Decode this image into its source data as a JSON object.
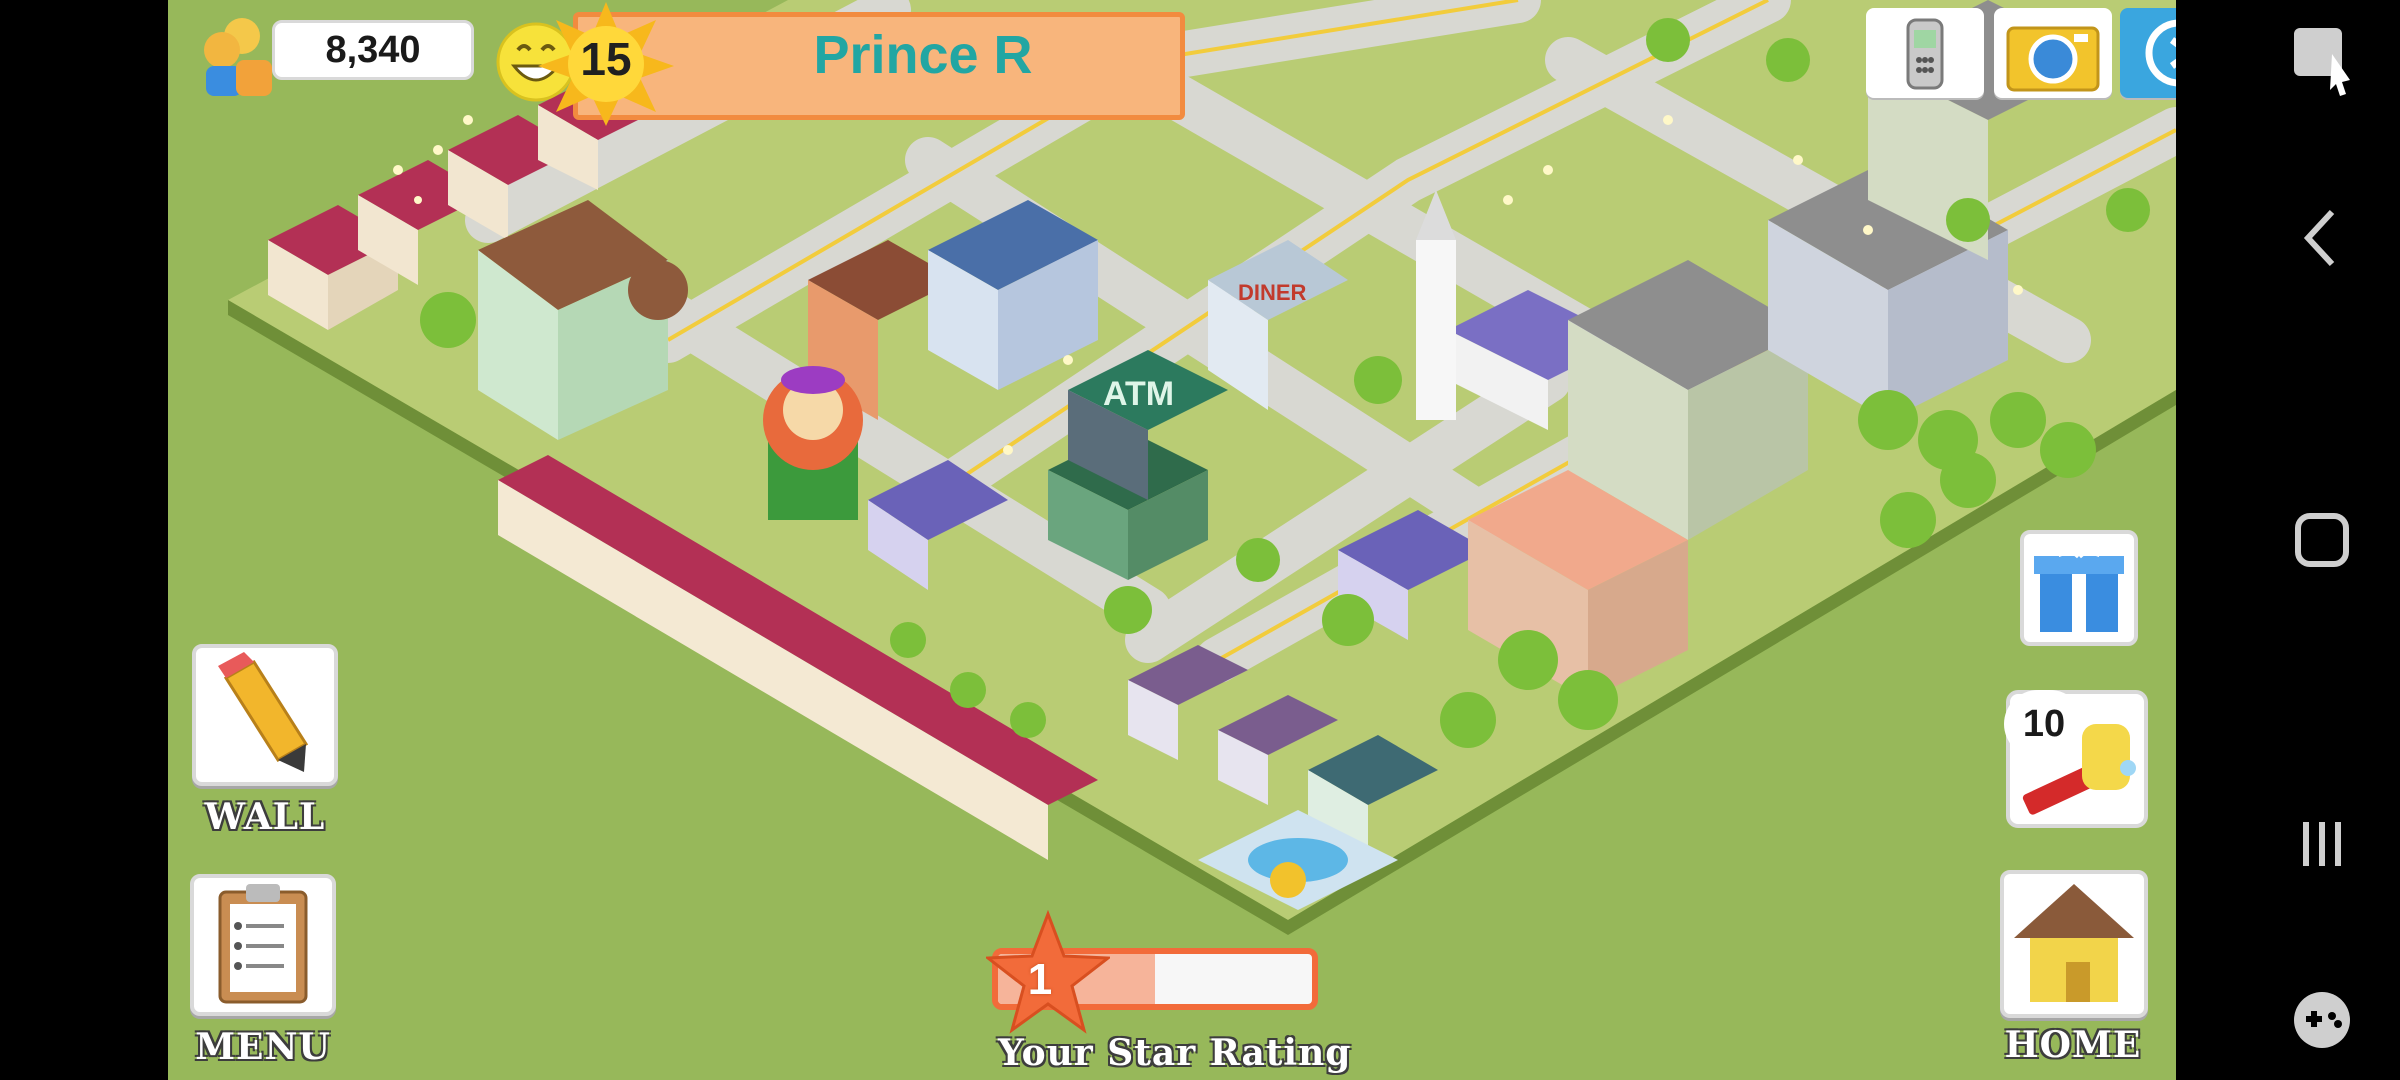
{
  "hud": {
    "coins": "8,340",
    "level": "15",
    "player_name": "Prince R",
    "cleanup_count": "10"
  },
  "buttons": {
    "wall_label": "WALL",
    "menu_label": "MENU",
    "home_label": "HOME"
  },
  "rating": {
    "value": "1",
    "label": "Your Star Rating",
    "progress_fraction": 0.5
  },
  "icons": {
    "coins": "coins-people-icon",
    "happiness": "smiley-face-icon",
    "level": "sun-star-icon",
    "phone": "mobile-phone-icon",
    "camera": "camera-icon",
    "share": "share-icon",
    "gift": "gift-icon",
    "cleanup": "cleaning-tools-icon",
    "wall": "pencil-icon",
    "menu": "clipboard-icon",
    "home": "house-icon",
    "nav_screenshot": "screenshot-icon",
    "nav_back": "back-chevron-icon",
    "nav_home": "home-square-icon",
    "nav_recents": "recent-apps-icon",
    "nav_game": "gamepad-icon"
  },
  "colors": {
    "grass": "#97b85a",
    "banner": "#f8b57c",
    "name_text": "#22a6a3",
    "rating_border": "#f26b3a"
  }
}
